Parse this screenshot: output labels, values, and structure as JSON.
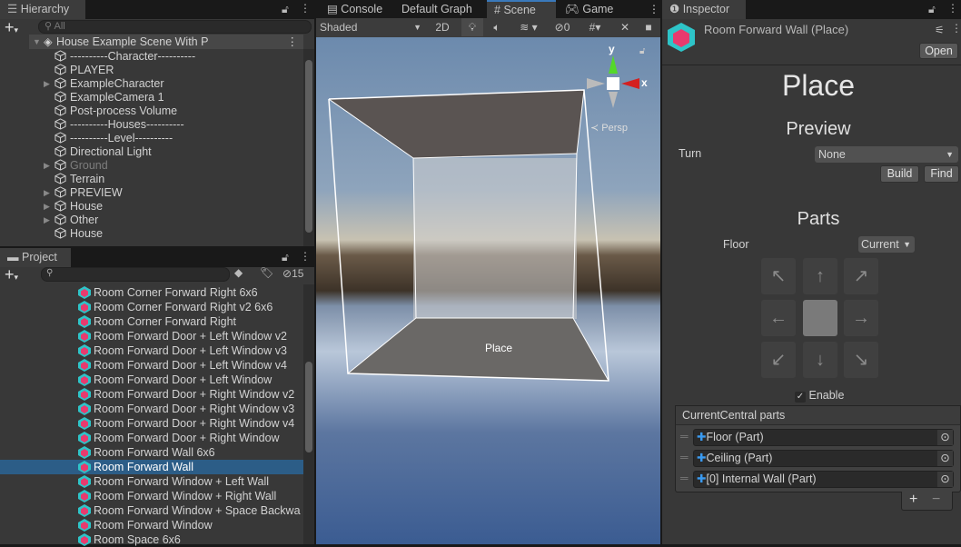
{
  "hierarchy": {
    "title": "Hierarchy",
    "search_placeholder": "All",
    "scene_name": "House Example Scene With P",
    "items": [
      {
        "label": "----------Character----------",
        "expandable": false,
        "disabled": false
      },
      {
        "label": "PLAYER",
        "expandable": false,
        "disabled": false
      },
      {
        "label": "ExampleCharacter",
        "expandable": true,
        "disabled": false
      },
      {
        "label": "ExampleCamera 1",
        "expandable": false,
        "disabled": false
      },
      {
        "label": "Post-process Volume",
        "expandable": false,
        "disabled": false
      },
      {
        "label": "----------Houses----------",
        "expandable": false,
        "disabled": false
      },
      {
        "label": "----------Level----------",
        "expandable": false,
        "disabled": false
      },
      {
        "label": "Directional Light",
        "expandable": false,
        "disabled": false
      },
      {
        "label": "Ground",
        "expandable": true,
        "disabled": true
      },
      {
        "label": "Terrain",
        "expandable": false,
        "disabled": false
      },
      {
        "label": "PREVIEW",
        "expandable": true,
        "disabled": false
      },
      {
        "label": "House",
        "expandable": true,
        "disabled": false
      },
      {
        "label": "Other",
        "expandable": true,
        "disabled": false
      },
      {
        "label": "House",
        "expandable": false,
        "disabled": false
      }
    ]
  },
  "project": {
    "title": "Project",
    "hidden_count": "15",
    "selected_index": 12,
    "items": [
      "Room Corner Forward Right 6x6",
      "Room Corner Forward Right v2 6x6",
      "Room Corner Forward Right",
      "Room Forward Door + Left Window v2",
      "Room Forward Door + Left Window v3",
      "Room Forward Door + Left Window v4",
      "Room Forward Door + Left Window",
      "Room Forward Door + Right Window v2",
      "Room Forward Door + Right Window v3",
      "Room Forward Door + Right Window v4",
      "Room Forward Door + Right Window",
      "Room Forward Wall 6x6",
      "Room Forward Wall",
      "Room Forward Window + Left Wall",
      "Room Forward Window + Right Wall",
      "Room Forward Window + Space Backwa",
      "Room Forward Window",
      "Room Space 6x6"
    ]
  },
  "scene": {
    "tabs": [
      "Console",
      "Default Graph",
      "Scene",
      "Game"
    ],
    "active_tab": "Scene",
    "shading": "Shaded",
    "mode_2d": "2D",
    "hidden_count": "0",
    "persp": "Persp",
    "gizmo_y": "y",
    "gizmo_x": "x",
    "object_label": "Place"
  },
  "inspector": {
    "title": "Inspector",
    "object_name": "Room Forward Wall (Place)",
    "open_label": "Open",
    "heading": "Place",
    "preview": {
      "title": "Preview",
      "turn_label": "Turn",
      "turn_value": "None",
      "build_label": "Build",
      "find_label": "Find"
    },
    "parts": {
      "title": "Parts",
      "floor_label": "Floor",
      "floor_value": "Current",
      "enable_label": "Enable",
      "enabled": true,
      "list_title": "CurrentCentral parts",
      "list": [
        "Floor (Part)",
        "Ceiling (Part)",
        "[0] Internal Wall (Part)"
      ],
      "add": "+",
      "remove": "−"
    }
  }
}
